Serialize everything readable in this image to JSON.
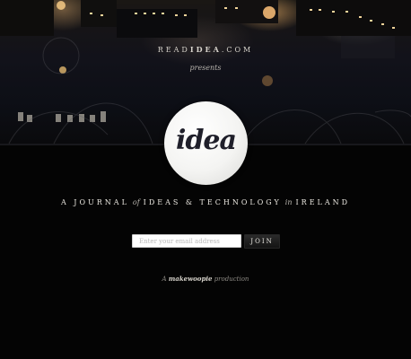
{
  "header": {
    "brand_prefix": "READ",
    "brand_name": "IDEA",
    "brand_suffix": ".COM",
    "presents": "presents"
  },
  "logo": {
    "text": "idea"
  },
  "tagline": {
    "part1": "A JOURNAL",
    "of": "of",
    "part2": "IDEAS & TECHNOLOGY",
    "in": "in",
    "part3": "IRELAND"
  },
  "signup": {
    "placeholder": "Enter your email address",
    "join_label": "JOIN"
  },
  "credit": {
    "prefix": "A",
    "brand": "makewoopie",
    "suffix": "production"
  },
  "colors": {
    "background": "#040404",
    "logo_circle": "#f4f4f2",
    "logo_text": "#1f1f2a",
    "tagline": "#ece9e2"
  }
}
